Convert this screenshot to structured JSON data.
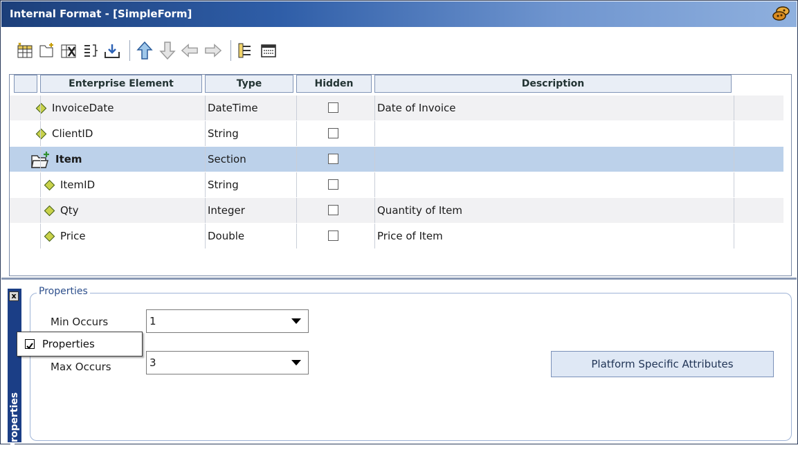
{
  "window": {
    "title": "Internal Format - [SimpleForm]"
  },
  "toolbar": {
    "buttons": [
      {
        "icon": "add-element-icon"
      },
      {
        "icon": "add-section-icon"
      },
      {
        "icon": "delete-element-icon"
      },
      {
        "icon": "indent-list-icon"
      },
      {
        "icon": "import-icon"
      },
      {
        "icon": "move-up-icon"
      },
      {
        "icon": "move-down-icon"
      },
      {
        "icon": "move-left-icon"
      },
      {
        "icon": "move-right-icon"
      },
      {
        "icon": "tree-view-icon"
      },
      {
        "icon": "form-view-icon"
      }
    ]
  },
  "grid": {
    "columns": [
      "Enterprise Element",
      "Type",
      "Hidden",
      "Description"
    ],
    "rows": [
      {
        "name": "InvoiceDate",
        "type": "DateTime",
        "hidden": false,
        "description": "Date of Invoice",
        "kind": "element",
        "level": 0
      },
      {
        "name": "ClientID",
        "type": "String",
        "hidden": false,
        "description": "",
        "kind": "element",
        "level": 0
      },
      {
        "name": "Item",
        "type": "Section",
        "hidden": false,
        "description": "",
        "kind": "section",
        "level": 0,
        "selected": true
      },
      {
        "name": "ItemID",
        "type": "String",
        "hidden": false,
        "description": "",
        "kind": "element",
        "level": 1
      },
      {
        "name": "Qty",
        "type": "Integer",
        "hidden": false,
        "description": "Quantity of Item",
        "kind": "element",
        "level": 1
      },
      {
        "name": "Price",
        "type": "Double",
        "hidden": false,
        "description": "Price of Item",
        "kind": "element",
        "level": 1
      }
    ]
  },
  "properties": {
    "tab_label": "Properties",
    "group_title": "Properties",
    "min_occurs_label": "Min Occurs",
    "min_occurs_value": "1",
    "max_occurs_label": "Max Occurs",
    "max_occurs_value": "3",
    "platform_button": "Platform Specific Attributes",
    "close_glyph": "x"
  },
  "popup": {
    "label": "Properties",
    "checked": true
  },
  "colors": {
    "selected_row": "#bcd1ea",
    "title_bar": "#1c3f7a",
    "panel_tab": "#1b3e86"
  }
}
